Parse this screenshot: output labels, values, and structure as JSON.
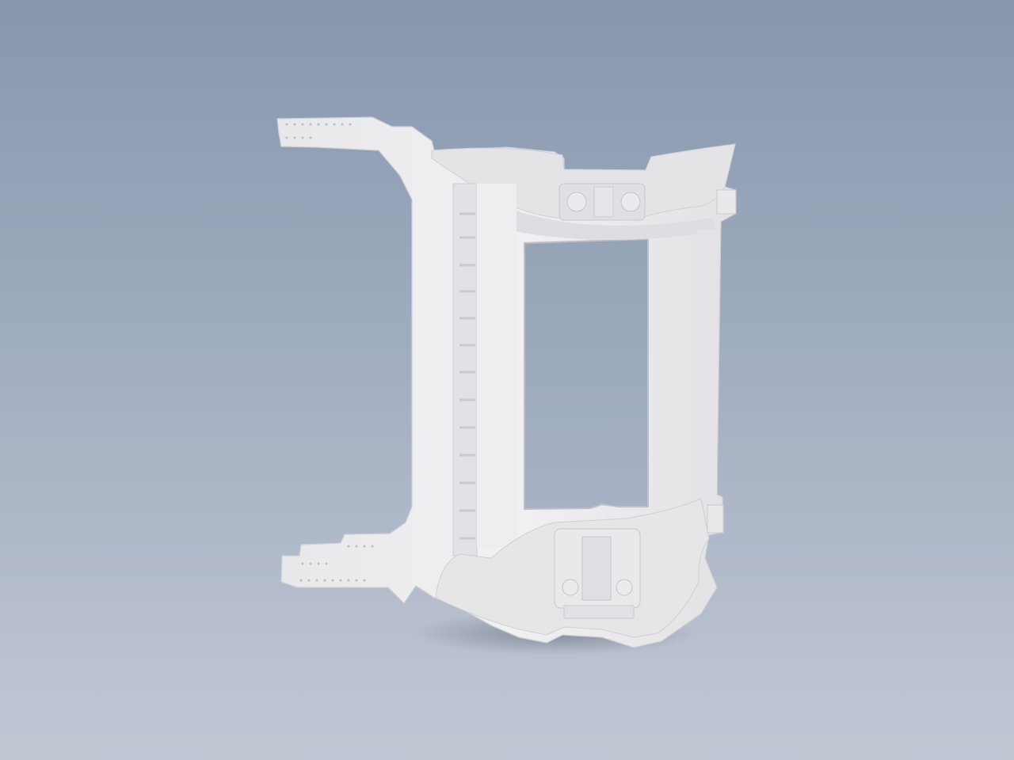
{
  "viewport": {
    "background_top": "#8797ae",
    "background_bottom": "#c2c7d4"
  },
  "model": {
    "part_color": "#ececee",
    "shade_color": "#d9d9dd",
    "edge_color": "#c4c4ca",
    "opening_color": "#a0acbe"
  }
}
